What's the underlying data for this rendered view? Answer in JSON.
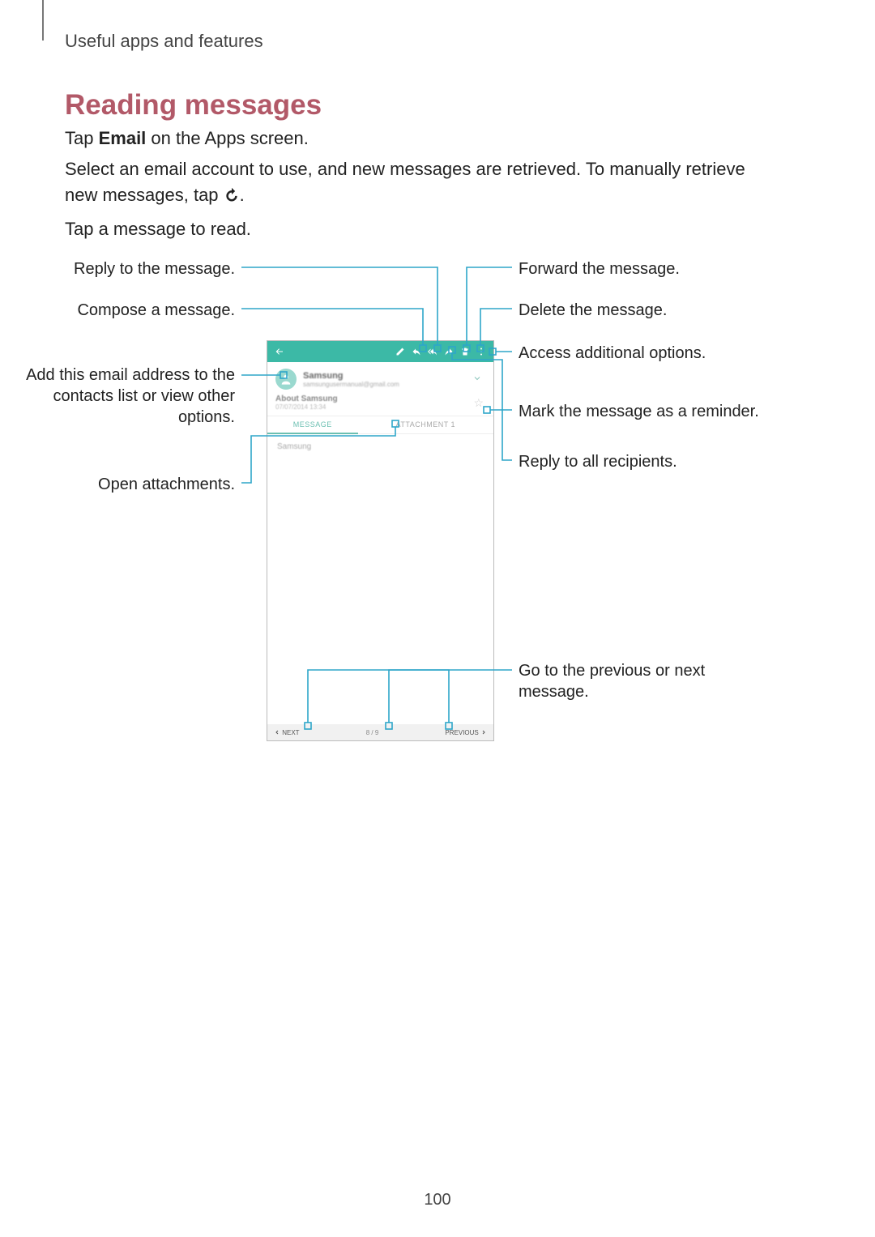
{
  "header": "Useful apps and features",
  "section_title": "Reading messages",
  "para1_pre": "Tap ",
  "para1_bold": "Email",
  "para1_post": " on the Apps screen.",
  "para2_pre": "Select an email account to use, and new messages are retrieved. To manually retrieve new messages, tap ",
  "para2_post": ".",
  "para3": "Tap a message to read.",
  "callouts": {
    "reply": "Reply to the message.",
    "compose": "Compose a message.",
    "add_contact": "Add this email address to the contacts list or view other options.",
    "open_attach": "Open attachments.",
    "forward": "Forward the message.",
    "delete": "Delete the message.",
    "options": "Access additional options.",
    "mark_reminder": "Mark the message as a reminder.",
    "reply_all": "Reply to all recipients.",
    "prevnext": "Go to the previous or next message."
  },
  "phone": {
    "sender_name": "Samsung",
    "sender_mail": "samsungusermanual@gmail.com",
    "subject": "About Samsung",
    "date": "07/07/2014 13:34",
    "tab_message": "MESSAGE",
    "tab_attach": "ATTACHMENT 1",
    "body_first": "Samsung",
    "footer_next": "NEXT",
    "footer_count": "8 / 9",
    "footer_prev": "PREVIOUS"
  },
  "page_number": "100"
}
